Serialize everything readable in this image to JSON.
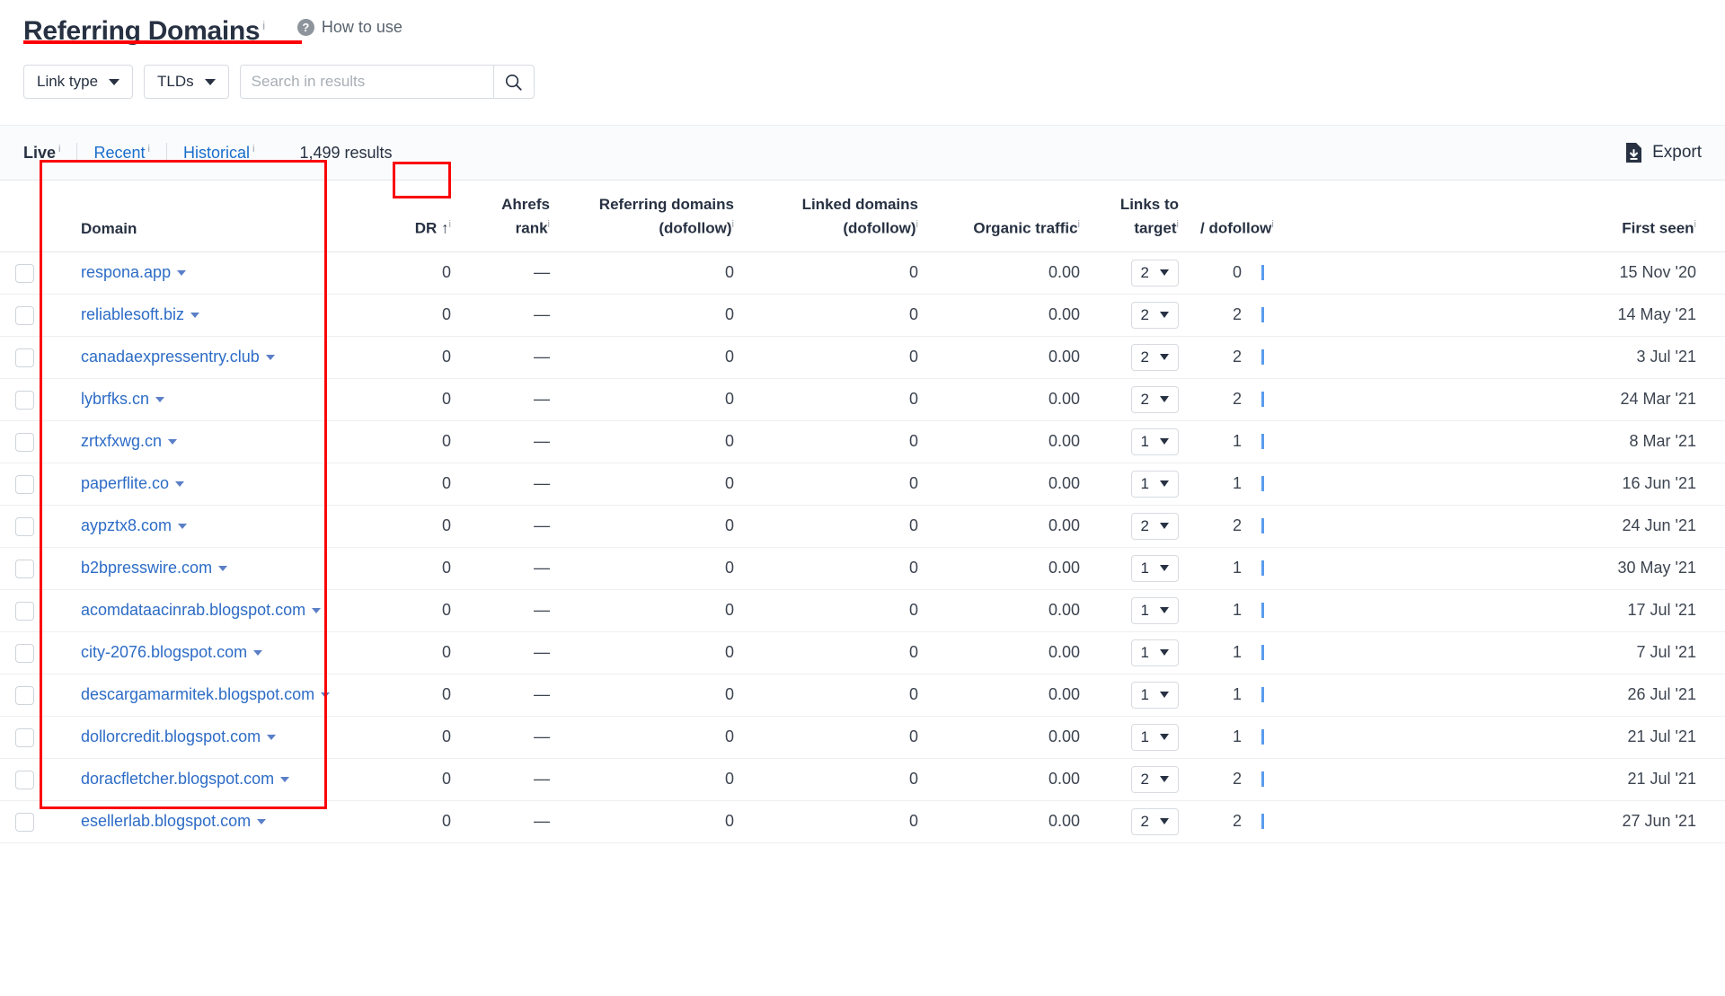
{
  "header": {
    "title": "Referring Domains",
    "title_info": "i",
    "how_to_use": "How to use",
    "help_icon": "question-mark-icon"
  },
  "filters": {
    "link_type": "Link type",
    "tlds": "TLDs",
    "search_placeholder": "Search in results",
    "search_value": "",
    "search_icon": "search-icon"
  },
  "toolbar": {
    "tabs": [
      {
        "label": "Live",
        "info": "i",
        "active": true
      },
      {
        "label": "Recent",
        "info": "i",
        "active": false
      },
      {
        "label": "Historical",
        "info": "i",
        "active": false
      }
    ],
    "results": "1,499 results",
    "export_label": "Export",
    "export_icon": "download-file-icon"
  },
  "table": {
    "columns": {
      "domain": "Domain",
      "dr": "DR",
      "dr_sort": "↑",
      "ahrefs_rank_line1": "Ahrefs",
      "ahrefs_rank_line2": "rank",
      "referring_domains_line1": "Referring domains",
      "referring_domains_line2": "(dofollow)",
      "linked_domains_line1": "Linked domains",
      "linked_domains_line2": "(dofollow)",
      "organic_traffic": "Organic traffic",
      "links_to_target_line1": "Links to",
      "links_to_target_line2": "target",
      "dofollow": "/ dofollow",
      "first_seen": "First seen",
      "info_marker": "i"
    },
    "rows": [
      {
        "domain": "respona.app",
        "dr": "0",
        "ahrefs_rank": "—",
        "referring_domains": "0",
        "linked_domains": "0",
        "organic_traffic": "0.00",
        "links_to_target": "2",
        "dofollow": "0",
        "first_seen": "15 Nov '20"
      },
      {
        "domain": "reliablesoft.biz",
        "dr": "0",
        "ahrefs_rank": "—",
        "referring_domains": "0",
        "linked_domains": "0",
        "organic_traffic": "0.00",
        "links_to_target": "2",
        "dofollow": "2",
        "first_seen": "14 May '21"
      },
      {
        "domain": "canadaexpressentry.club",
        "dr": "0",
        "ahrefs_rank": "—",
        "referring_domains": "0",
        "linked_domains": "0",
        "organic_traffic": "0.00",
        "links_to_target": "2",
        "dofollow": "2",
        "first_seen": "3 Jul '21"
      },
      {
        "domain": "lybrfks.cn",
        "dr": "0",
        "ahrefs_rank": "—",
        "referring_domains": "0",
        "linked_domains": "0",
        "organic_traffic": "0.00",
        "links_to_target": "2",
        "dofollow": "2",
        "first_seen": "24 Mar '21"
      },
      {
        "domain": "zrtxfxwg.cn",
        "dr": "0",
        "ahrefs_rank": "—",
        "referring_domains": "0",
        "linked_domains": "0",
        "organic_traffic": "0.00",
        "links_to_target": "1",
        "dofollow": "1",
        "first_seen": "8 Mar '21"
      },
      {
        "domain": "paperflite.co",
        "dr": "0",
        "ahrefs_rank": "—",
        "referring_domains": "0",
        "linked_domains": "0",
        "organic_traffic": "0.00",
        "links_to_target": "1",
        "dofollow": "1",
        "first_seen": "16 Jun '21"
      },
      {
        "domain": "aypztx8.com",
        "dr": "0",
        "ahrefs_rank": "—",
        "referring_domains": "0",
        "linked_domains": "0",
        "organic_traffic": "0.00",
        "links_to_target": "2",
        "dofollow": "2",
        "first_seen": "24 Jun '21"
      },
      {
        "domain": "b2bpresswire.com",
        "dr": "0",
        "ahrefs_rank": "—",
        "referring_domains": "0",
        "linked_domains": "0",
        "organic_traffic": "0.00",
        "links_to_target": "1",
        "dofollow": "1",
        "first_seen": "30 May '21"
      },
      {
        "domain": "acomdataacinrab.blogspot.com",
        "dr": "0",
        "ahrefs_rank": "—",
        "referring_domains": "0",
        "linked_domains": "0",
        "organic_traffic": "0.00",
        "links_to_target": "1",
        "dofollow": "1",
        "first_seen": "17 Jul '21"
      },
      {
        "domain": "city-2076.blogspot.com",
        "dr": "0",
        "ahrefs_rank": "—",
        "referring_domains": "0",
        "linked_domains": "0",
        "organic_traffic": "0.00",
        "links_to_target": "1",
        "dofollow": "1",
        "first_seen": "7 Jul '21"
      },
      {
        "domain": "descargamarmitek.blogspot.com",
        "dr": "0",
        "ahrefs_rank": "—",
        "referring_domains": "0",
        "linked_domains": "0",
        "organic_traffic": "0.00",
        "links_to_target": "1",
        "dofollow": "1",
        "first_seen": "26 Jul '21"
      },
      {
        "domain": "dollorcredit.blogspot.com",
        "dr": "0",
        "ahrefs_rank": "—",
        "referring_domains": "0",
        "linked_domains": "0",
        "organic_traffic": "0.00",
        "links_to_target": "1",
        "dofollow": "1",
        "first_seen": "21 Jul '21"
      },
      {
        "domain": "doracfletcher.blogspot.com",
        "dr": "0",
        "ahrefs_rank": "—",
        "referring_domains": "0",
        "linked_domains": "0",
        "organic_traffic": "0.00",
        "links_to_target": "2",
        "dofollow": "2",
        "first_seen": "21 Jul '21"
      },
      {
        "domain": "esellerlab.blogspot.com",
        "dr": "0",
        "ahrefs_rank": "—",
        "referring_domains": "0",
        "linked_domains": "0",
        "organic_traffic": "0.00",
        "links_to_target": "2",
        "dofollow": "2",
        "first_seen": "27 Jun '21"
      }
    ]
  },
  "annotations": {
    "accent_color": "#fb0007",
    "link_color": "#2d6cc6",
    "highlighted": [
      "page-title",
      "domain-column",
      "dr-column-header"
    ]
  }
}
